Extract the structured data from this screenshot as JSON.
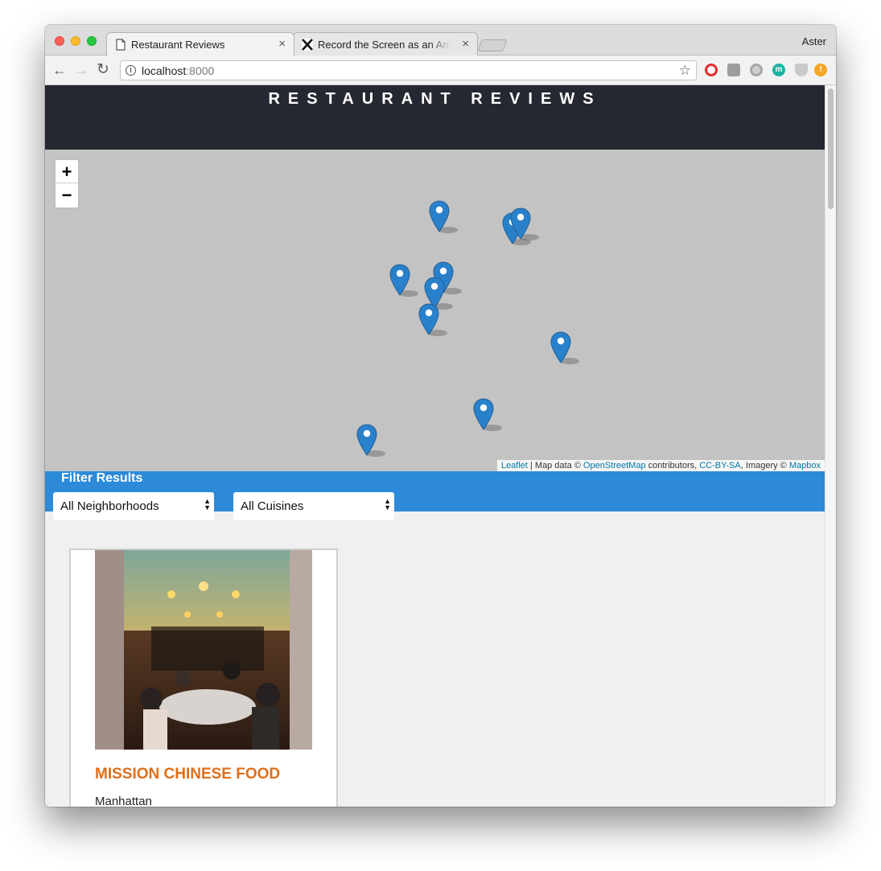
{
  "browser": {
    "tabs": [
      {
        "title": "Restaurant Reviews",
        "favicon": "page-icon",
        "active": true
      },
      {
        "title": "Record the Screen as an Anima",
        "favicon": "x-logo-icon",
        "active": false
      }
    ],
    "profile_name": "Aster",
    "url_host": "localhost",
    "url_port": ":8000",
    "close_glyph": "×"
  },
  "site": {
    "title": "RESTAURANT REVIEWS"
  },
  "map": {
    "zoom_in": "+",
    "zoom_out": "−",
    "attribution": {
      "leaflet": "Leaflet",
      "sep1": " | Map data © ",
      "osm": "OpenStreetMap",
      "sep2": " contributors, ",
      "license": "CC-BY-SA",
      "sep3": ", Imagery © ",
      "mapbox": "Mapbox"
    },
    "marker_color": "#2a81cb",
    "marker_count": 10
  },
  "filters": {
    "title": "Filter Results",
    "neighborhood_selected": "All Neighborhoods",
    "cuisine_selected": "All Cuisines"
  },
  "restaurants": [
    {
      "name": "MISSION CHINESE FOOD",
      "neighborhood": "Manhattan"
    }
  ],
  "colors": {
    "header_bg": "#252831",
    "filter_bg": "#2c8ad8",
    "name_accent": "#e06f19",
    "link": "#0078a8"
  }
}
